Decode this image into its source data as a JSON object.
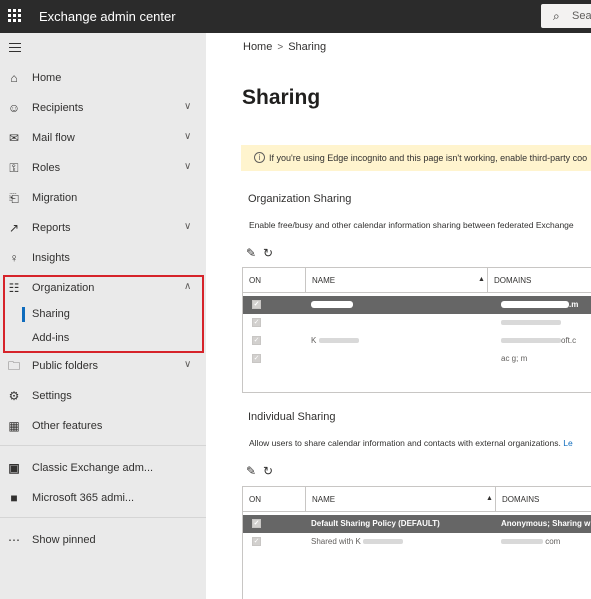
{
  "topbar": {
    "app_title": "Exchange admin center",
    "search_placeholder": "Sea"
  },
  "sidebar": {
    "items": [
      {
        "label": "Home",
        "icon": "home-icon"
      },
      {
        "label": "Recipients",
        "icon": "person-icon",
        "expandable": true
      },
      {
        "label": "Mail flow",
        "icon": "mail-icon",
        "expandable": true
      },
      {
        "label": "Roles",
        "icon": "person-key-icon",
        "expandable": true
      },
      {
        "label": "Migration",
        "icon": "document-icon"
      },
      {
        "label": "Reports",
        "icon": "chart-icon",
        "expandable": true
      },
      {
        "label": "Insights",
        "icon": "lightbulb-icon"
      },
      {
        "label": "Organization",
        "icon": "org-chart-icon",
        "expanded": true
      },
      {
        "label": "Public folders",
        "icon": "folder-icon",
        "expandable": true
      },
      {
        "label": "Settings",
        "icon": "gear-icon"
      },
      {
        "label": "Other features",
        "icon": "grid-icon"
      },
      {
        "label": "Classic Exchange adm...",
        "icon": "exchange-logo-icon"
      },
      {
        "label": "Microsoft 365 admi...",
        "icon": "office-logo-icon"
      },
      {
        "label": "Show pinned",
        "icon": "ellipsis-icon"
      }
    ],
    "organization_subitems": [
      {
        "label": "Sharing",
        "active": true
      },
      {
        "label": "Add-ins"
      }
    ]
  },
  "breadcrumb": {
    "home": "Home",
    "current": "Sharing"
  },
  "page_title": "Sharing",
  "banner": {
    "text": "If you're using Edge incognito and this page isn't working, enable third-party coo"
  },
  "organization_sharing": {
    "title": "Organization Sharing",
    "description": "Enable free/busy and other calendar information sharing between federated Exchange",
    "columns": [
      "ON",
      "NAME",
      "DOMAINS"
    ],
    "rows": [
      {
        "name_prefix": "",
        "domain": ".m",
        "selected": true
      },
      {
        "name_prefix": "",
        "domain": ""
      },
      {
        "name_prefix": "K",
        "domain": "oft.c"
      },
      {
        "name_prefix": "",
        "domain": "ac  g; m"
      }
    ]
  },
  "individual_sharing": {
    "title": "Individual Sharing",
    "description": "Allow users to share calendar information and contacts with external organizations.",
    "description_link": "Le",
    "columns": [
      "ON",
      "NAME",
      "DOMAINS"
    ],
    "rows": [
      {
        "name": "Default Sharing Policy (DEFAULT)",
        "domain": "Anonymous; Sharing w",
        "selected": true
      },
      {
        "name": "Shared with K",
        "domain": "com"
      }
    ]
  },
  "colors": {
    "topbar_bg": "#2b2b2b",
    "sidebar_bg": "#eaeaea",
    "accent": "#0f6cbd",
    "highlight_border": "#d6232a",
    "banner_bg": "#fff4ce",
    "selected_row_bg": "#666666"
  }
}
